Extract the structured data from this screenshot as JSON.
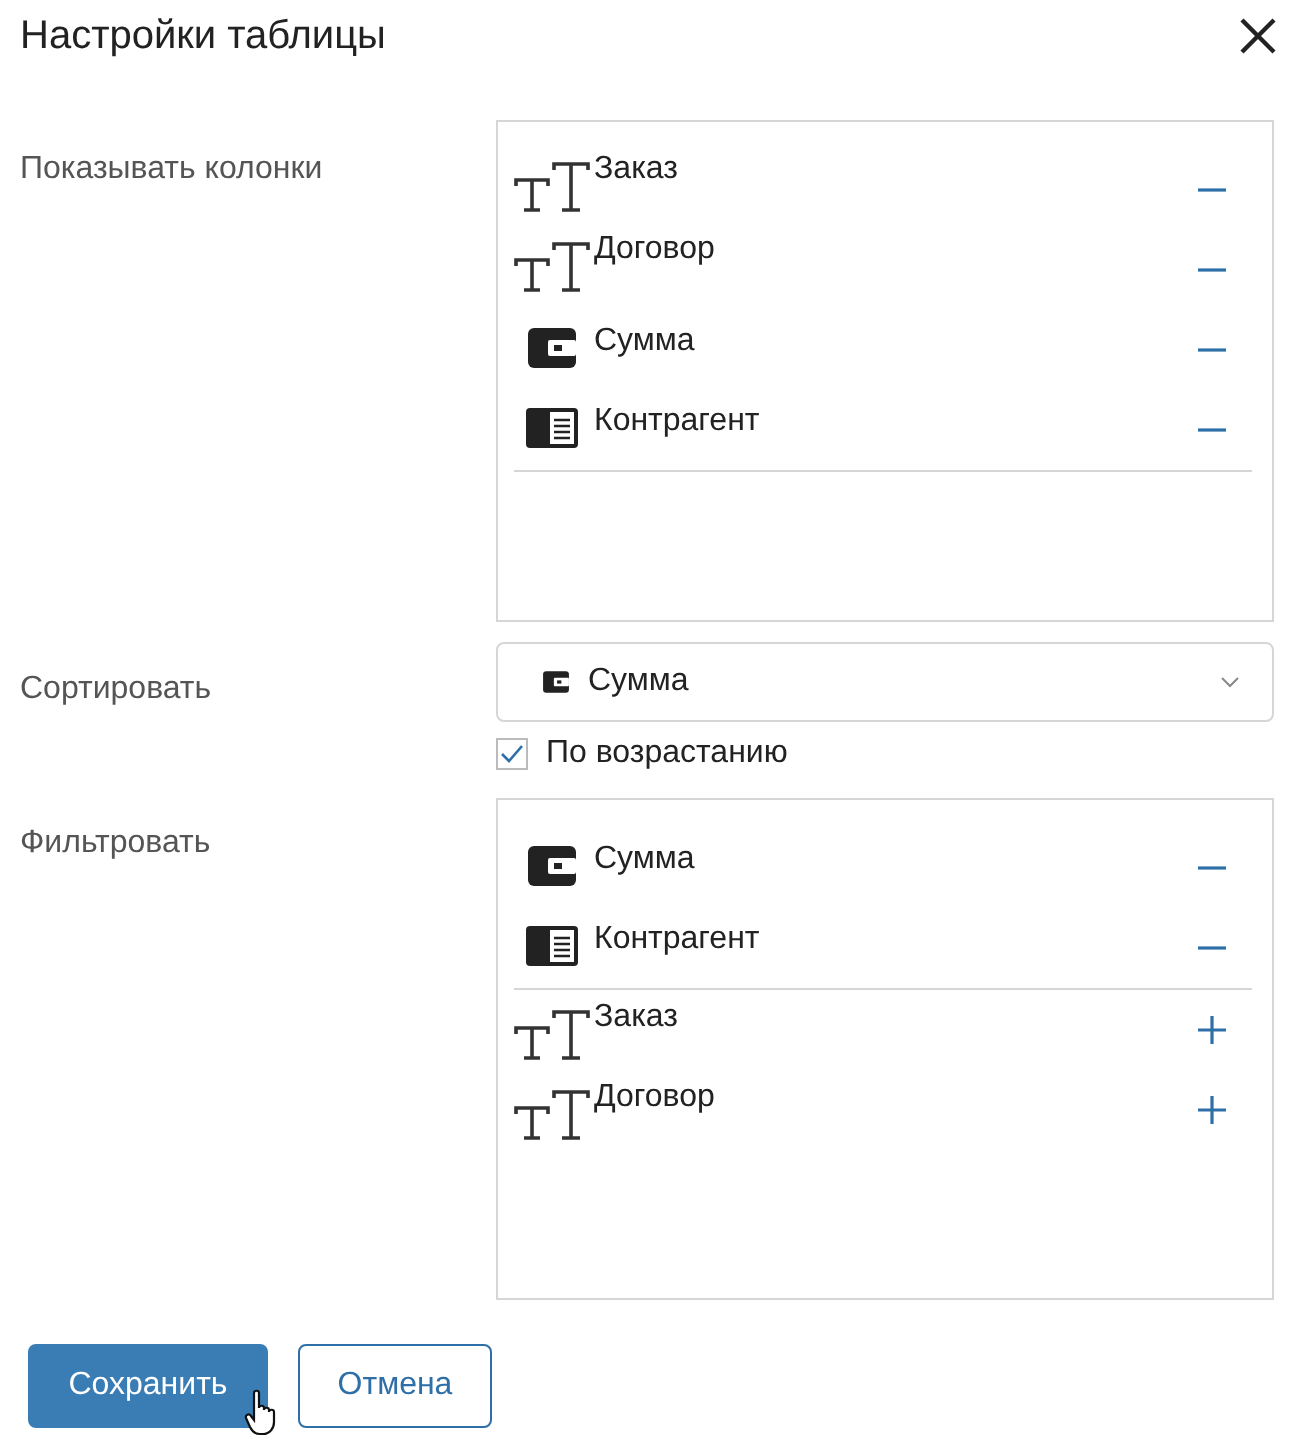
{
  "title": "Настройки таблицы",
  "columns": {
    "label": "Показывать колонки",
    "items": [
      {
        "kind": "text",
        "name": "Заказ",
        "included": true
      },
      {
        "kind": "text",
        "name": "Договор",
        "included": true
      },
      {
        "kind": "money",
        "name": "Сумма",
        "included": true
      },
      {
        "kind": "contact",
        "name": "Контрагент",
        "included": true
      }
    ]
  },
  "sort": {
    "label": "Сортировать",
    "value": {
      "kind": "money",
      "name": "Сумма"
    },
    "ascending_label": "По возрастанию",
    "ascending": true
  },
  "filter": {
    "label": "Фильтровать",
    "items": [
      {
        "kind": "money",
        "name": "Сумма",
        "included": true
      },
      {
        "kind": "contact",
        "name": "Контрагент",
        "included": true
      },
      {
        "kind": "text",
        "name": "Заказ",
        "included": false
      },
      {
        "kind": "text",
        "name": "Договор",
        "included": false
      }
    ]
  },
  "buttons": {
    "save": "Сохранить",
    "cancel": "Отмена"
  }
}
